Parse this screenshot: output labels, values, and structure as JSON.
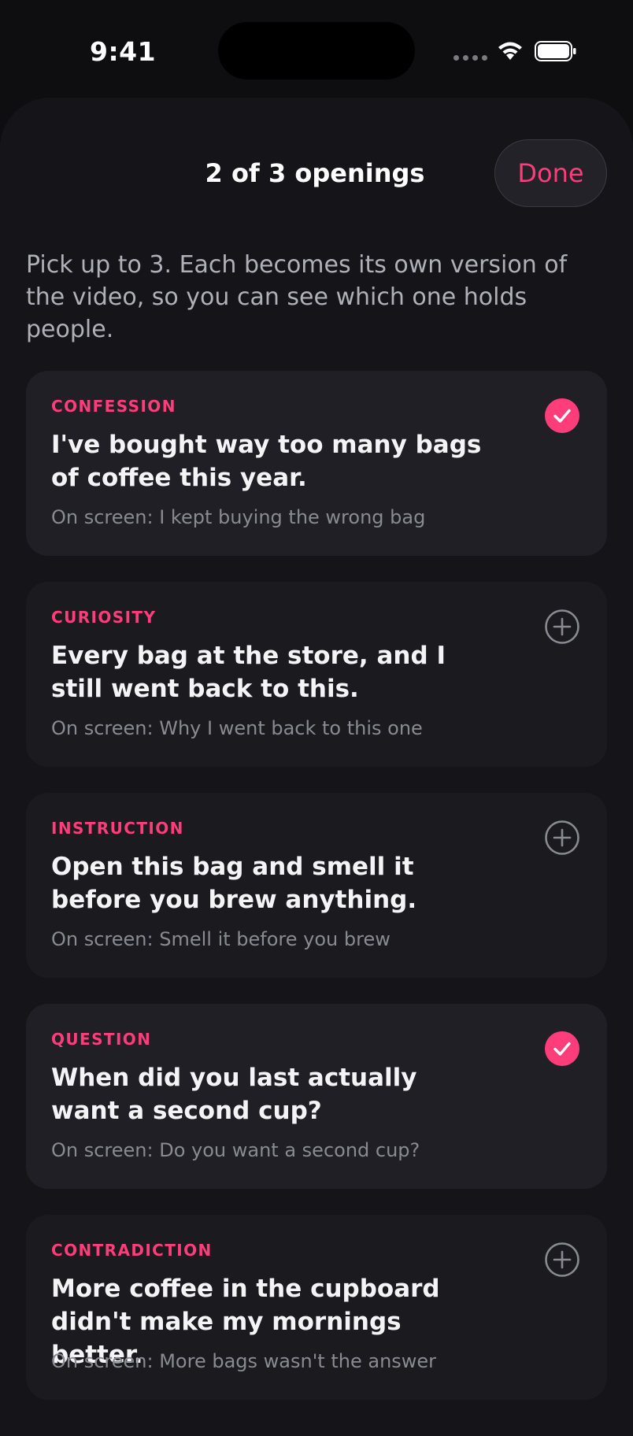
{
  "status": {
    "time": "9:41"
  },
  "sheet": {
    "title": "2 of 3 openings",
    "done_label": "Done",
    "intro": "Pick up to 3. Each becomes its own version of the video, so you can see which one holds people."
  },
  "colors": {
    "accent": "#ff3d7a",
    "background": "#0e0e11",
    "card": "#1f1f25"
  },
  "openings": [
    {
      "category": "CONFESSION",
      "hook": "I've bought way too many bags of coffee this year.",
      "on_screen": "On screen: I kept buying the wrong bag",
      "selected": true
    },
    {
      "category": "CURIOSITY",
      "hook": "Every bag at the store, and I still went back to this.",
      "on_screen": "On screen: Why I went back to this one",
      "selected": false
    },
    {
      "category": "INSTRUCTION",
      "hook": "Open this bag and smell it before you brew anything.",
      "on_screen": "On screen: Smell it before you brew",
      "selected": false
    },
    {
      "category": "QUESTION",
      "hook": "When did you last actually want a second cup?",
      "on_screen": "On screen: Do you want a second cup?",
      "selected": true
    },
    {
      "category": "CONTRADICTION",
      "hook": "More coffee in the cupboard didn't make my mornings better.",
      "on_screen": "On screen: More bags wasn't the answer",
      "selected": false
    }
  ]
}
